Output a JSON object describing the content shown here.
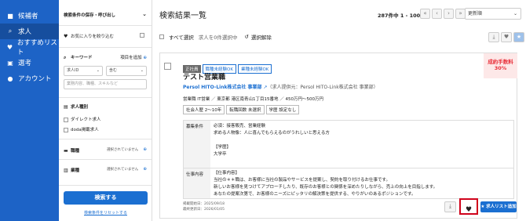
{
  "nav": {
    "items": [
      {
        "icon": "■",
        "label": "候補者"
      },
      {
        "icon": "⌕",
        "label": "求人"
      },
      {
        "icon": "♥",
        "label": "おすすめリスト"
      },
      {
        "icon": "▣",
        "label": "選考"
      },
      {
        "icon": "●",
        "label": "アカウント"
      }
    ]
  },
  "filters": {
    "save_label": "検索条件の保存・呼び出し",
    "favorites_label": "お気に入りを絞り込む",
    "keyword_label": "キーワード",
    "add_item_label": "項目を追加",
    "keyword_type": "求人ID",
    "keyword_match": "含む",
    "keyword_placeholder": "業務内容、職種、スキルなど",
    "job_type_label": "求人種別",
    "direct_label": "ダイレクト求人",
    "doda_label": "doda掲載求人",
    "occupation_label": "職種",
    "occupation_value": "選択されていません",
    "industry_label": "業種",
    "industry_value": "選択されていません",
    "search_button": "検索する",
    "reset_label": "検索条件をリセットする"
  },
  "main": {
    "title": "検索結果一覧",
    "count": "287件中 1 - 100件",
    "sort": "更新順",
    "select_all": "すべて選択",
    "selected_info": "求人を0件選択中",
    "clear_selection": "選択解除"
  },
  "job": {
    "tags": [
      "正社員",
      "職種未経験OK",
      "業種未経験OK"
    ],
    "title": "テスト営業職",
    "company": "Persol HITO-Link株式会社 事業部",
    "provider": "（求人提供元：Persol HITO-Link株式会社 事業部）",
    "meta": "営業職 IT営業 ／ 東京都 港区南青山1丁目15番地 ／ 450万円〜500万円",
    "badges": [
      "社会人歴 2〜10年",
      "転職回数 未選択",
      "学歴 設定なし"
    ],
    "fee_label": "成約手数料",
    "fee_value": "30%",
    "req_label": "募集条件",
    "req_lines": [
      "必須：接客販売、営業経験",
      "求める人物像：人に喜んでもらえるのがうれしいと思える方",
      "",
      "【学歴】",
      "大学卒"
    ],
    "work_label": "仕事内容",
    "work_lines": [
      "【仕事内容】",
      "当社の＊＊職は、お客様に当社の製品やサービスを提案し、契約を取り付けるお仕事です。",
      "新しいお客様を見つけてアプローチしたり、既存のお客様との関係を深めたりしながら、売上の向上を目指します。",
      "あなたの提案次第で、お客様のニーズにピッタリの解決策を提供する、やりがいのあるポジションです。"
    ],
    "posted": "掲載開始日：2025/09/18",
    "updated": "最終更新日：2026/01/05",
    "add_list": "求人リスト追加"
  },
  "colors": {
    "nav": "#1d63c6",
    "accent": "#1b6fd1",
    "fee": "#e8303a",
    "heart_border": "#d0021b"
  }
}
